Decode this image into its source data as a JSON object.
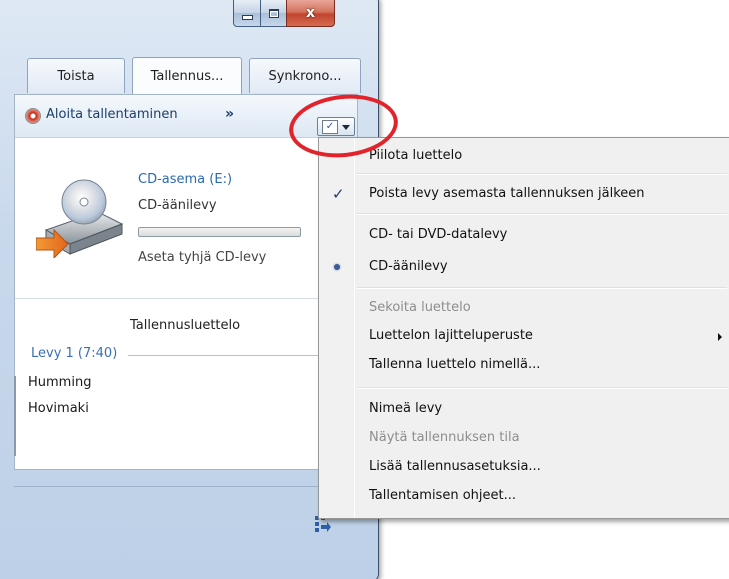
{
  "window": {
    "close_glyph": "x"
  },
  "tabs": [
    {
      "label": "Toista"
    },
    {
      "label": "Tallennus..."
    },
    {
      "label": "Synkrono..."
    }
  ],
  "toolbar": {
    "start_burn_label": "Aloita tallentaminen",
    "more_label": "»",
    "options_icon": "list-options-icon",
    "options_check": "✓"
  },
  "drive": {
    "name": "CD-asema (E:)",
    "type": "CD-äänilevy",
    "progress": 0,
    "hint": "Aseta tyhjä CD-levy"
  },
  "burn_list": {
    "title": "Tallennusluettelo",
    "disc_label": "Levy 1 (7:40)",
    "tracks": [
      "Humming",
      "Hovimaki"
    ]
  },
  "menu": {
    "items": [
      {
        "label": "Piilota luettelo",
        "enabled": true
      },
      {
        "label": "Poista levy asemasta tallennuksen jälkeen",
        "enabled": true,
        "checked": true
      },
      {
        "label": "CD- tai DVD-datalevy",
        "enabled": true
      },
      {
        "label": "CD-äänilevy",
        "enabled": true,
        "selected": true
      },
      {
        "label": "Sekoita luettelo",
        "enabled": false
      },
      {
        "label": "Luettelon lajitteluperuste",
        "enabled": true,
        "submenu": true
      },
      {
        "label": "Tallenna luettelo nimellä...",
        "enabled": true
      },
      {
        "label": "Nimeä levy",
        "enabled": true
      },
      {
        "label": "Näytä tallennuksen tila",
        "enabled": false
      },
      {
        "label": "Lisää tallennusasetuksia...",
        "enabled": true
      },
      {
        "label": "Tallentamisen ohjeet...",
        "enabled": true
      }
    ],
    "check_glyph": "✓"
  },
  "colors": {
    "highlight_ring": "#e3232b",
    "link_blue": "#2a6ab0"
  }
}
